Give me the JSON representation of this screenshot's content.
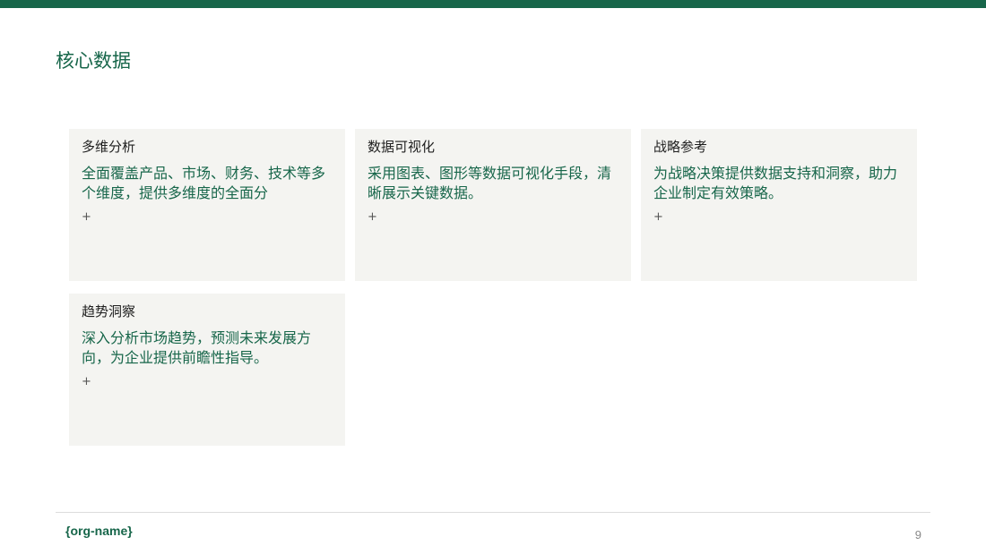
{
  "colors": {
    "accent": "#17664a",
    "card_background": "#f4f4f1",
    "title_text": "#1f1f1f"
  },
  "page": {
    "title": "核心数据"
  },
  "cards": [
    {
      "title": "多维分析",
      "description": "全面覆盖产品、市场、财务、技术等多个维度，提供多维度的全面分",
      "expand": "+"
    },
    {
      "title": "数据可视化",
      "description": "采用图表、图形等数据可视化手段，清晰展示关键数据。",
      "expand": "+"
    },
    {
      "title": "战略参考",
      "description": "为战略决策提供数据支持和洞察，助力企业制定有效策略。",
      "expand": "+"
    },
    {
      "title": "趋势洞察",
      "description": "深入分析市场趋势，预测未来发展方向，为企业提供前瞻性指导。",
      "expand": "+"
    }
  ],
  "footer": {
    "org_name": "{org-name}",
    "page_number": "9"
  }
}
